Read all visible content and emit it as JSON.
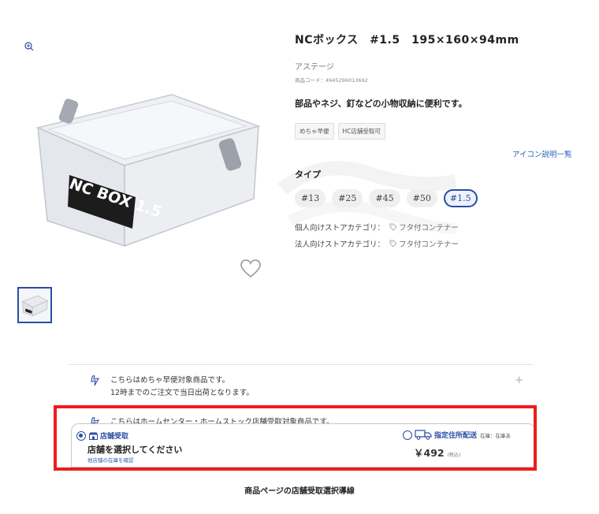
{
  "product": {
    "title": "NCボックス　#1.5　195×160×94mm",
    "maker": "アステージ",
    "code": "商品コード：4945296013692",
    "catch_copy": "部品やネジ、釘などの小物収納に便利です。",
    "tags": [
      "めちゃ早便",
      "HC店舗受取可"
    ],
    "icon_list_link": "アイコン説明一覧",
    "type_label": "タイプ",
    "variants": [
      "#13",
      "#25",
      "#45",
      "#50",
      "#1.5"
    ],
    "selected_variant": "#1.5",
    "categories": [
      {
        "label": "個人向けストアカテゴリ：",
        "value": "フタ付コンテナー"
      },
      {
        "label": "法人向けストアカテゴリ：",
        "value": "フタ付コンテナー"
      }
    ],
    "image_label": "NC BOX 1.5"
  },
  "notices": [
    {
      "line1": "こちらはめちゃ早便対象商品です。",
      "line2": "12時までのご注文で当日出荷となります。",
      "expand": "+"
    },
    {
      "line1": "こちらはホームセンター・ホームストック店舗受取対象商品です。"
    }
  ],
  "receive_panel": {
    "store_option_label": "店舗受取",
    "store_prompt": "店舗を選択してください",
    "other_stock_link": "他店舗の在庫を確認",
    "delivery_option_label": "指定住所配送",
    "stock_note": "在庫：在庫あ",
    "price": "￥492",
    "tax_note": "(税込)"
  },
  "caption": "商品ページの店舗受取選択導線",
  "colors": {
    "accent": "#2b4da3",
    "highlight": "#ee1c1c"
  }
}
